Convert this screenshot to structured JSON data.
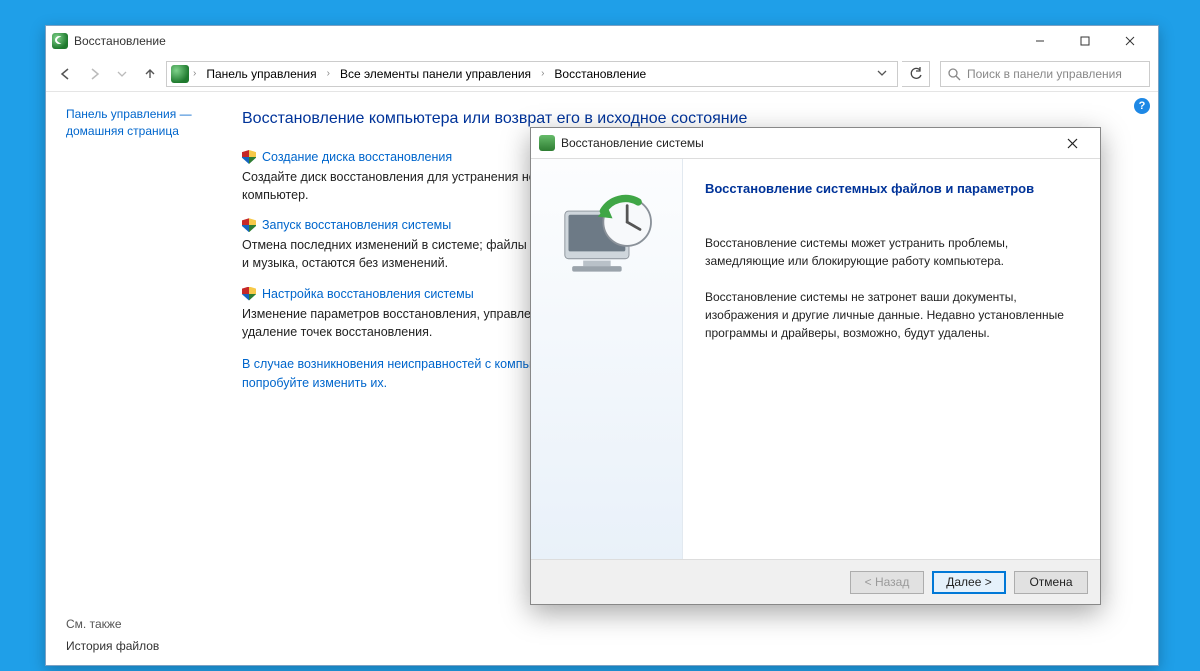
{
  "window": {
    "title": "Восстановление"
  },
  "nav": {
    "breadcrumbs": [
      "Панель управления",
      "Все элементы панели управления",
      "Восстановление"
    ]
  },
  "search": {
    "placeholder": "Поиск в панели управления"
  },
  "sidebar": {
    "home_label": "Панель управления — домашняя страница",
    "see_also": "См. также",
    "file_history": "История файлов"
  },
  "page": {
    "title": "Восстановление компьютера или возврат его в исходное состояние",
    "items": [
      {
        "link": "Создание диска восстановления",
        "desc": "Создайте диск восстановления для устранения неисправностей, когда не удается запустить компьютер."
      },
      {
        "link": "Запуск восстановления системы",
        "desc": "Отмена последних изменений в системе; файлы пользователей, такие как документы, изображения и музыка, остаются без изменений."
      },
      {
        "link": "Настройка восстановления системы",
        "desc": "Изменение параметров восстановления, управление пространством на диске, а также создание и удаление точек восстановления."
      }
    ],
    "trouble": "В случае возникновения неисправностей с компьютером перейдите к его параметрам и попробуйте изменить их."
  },
  "dialog": {
    "title": "Восстановление системы",
    "heading": "Восстановление системных файлов и параметров",
    "p1": "Восстановление системы может устранить проблемы, замедляющие или блокирующие работу компьютера.",
    "p2": "Восстановление системы не затронет ваши документы, изображения и другие личные данные. Недавно установленные программы и драйверы, возможно, будут удалены.",
    "buttons": {
      "back": "< Назад",
      "next": "Далее >",
      "cancel": "Отмена"
    }
  }
}
